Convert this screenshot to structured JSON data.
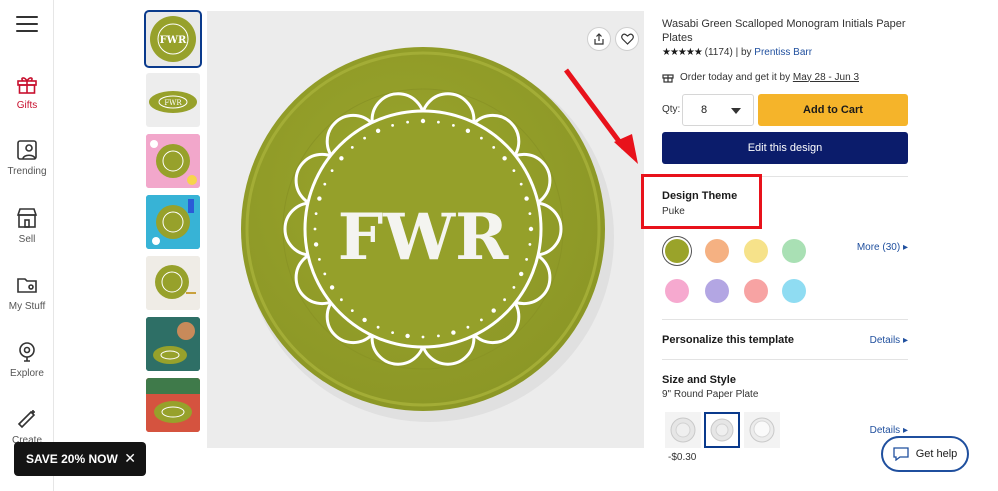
{
  "nav": {
    "items": [
      {
        "label": "Gifts",
        "icon": "gift-icon"
      },
      {
        "label": "Trending",
        "icon": "trending-icon"
      },
      {
        "label": "Sell",
        "icon": "store-icon"
      },
      {
        "label": "My Stuff",
        "icon": "folder-icon"
      },
      {
        "label": "Explore",
        "icon": "explore-icon"
      },
      {
        "label": "Create",
        "icon": "create-icon"
      }
    ],
    "active_color": "#c8102e"
  },
  "product": {
    "image_text": "FWR",
    "plate_color": "#97a12b",
    "title": "Wasabi Green Scalloped Monogram Initials Paper Plates",
    "stars": "★★★★★",
    "review_count": "(1174)",
    "by_label": "| by",
    "seller": "Prentiss Barr",
    "delivery_text": "Order today and get it by",
    "delivery_dates": "May 28 - Jun 3"
  },
  "purchase": {
    "qty_label": "Qty:",
    "qty_value": "8",
    "add_to_cart": "Add to Cart",
    "edit_design": "Edit this design"
  },
  "design_theme": {
    "heading": "Design Theme",
    "value": "Puke",
    "swatches": [
      "#9aa32a",
      "#f5b182",
      "#f6e28a",
      "#a9e0b4",
      "#f6a9cf",
      "#b3a6e3",
      "#f7a3a3",
      "#8fdcf2"
    ],
    "more_label": "More (30)"
  },
  "personalize": {
    "heading": "Personalize this template",
    "details_label": "Details"
  },
  "size_style": {
    "heading": "Size and Style",
    "value": "9\" Round Paper Plate",
    "details_label": "Details",
    "price": "-$0.30"
  },
  "promo": {
    "save_label": "SAVE 20% NOW",
    "close": "✕"
  },
  "help": {
    "label": "Get help"
  },
  "colors": {
    "accent_yellow": "#f5b42a",
    "navy": "#0b1c6b",
    "link": "#1f4f9e",
    "highlight_red": "#e8121b"
  }
}
